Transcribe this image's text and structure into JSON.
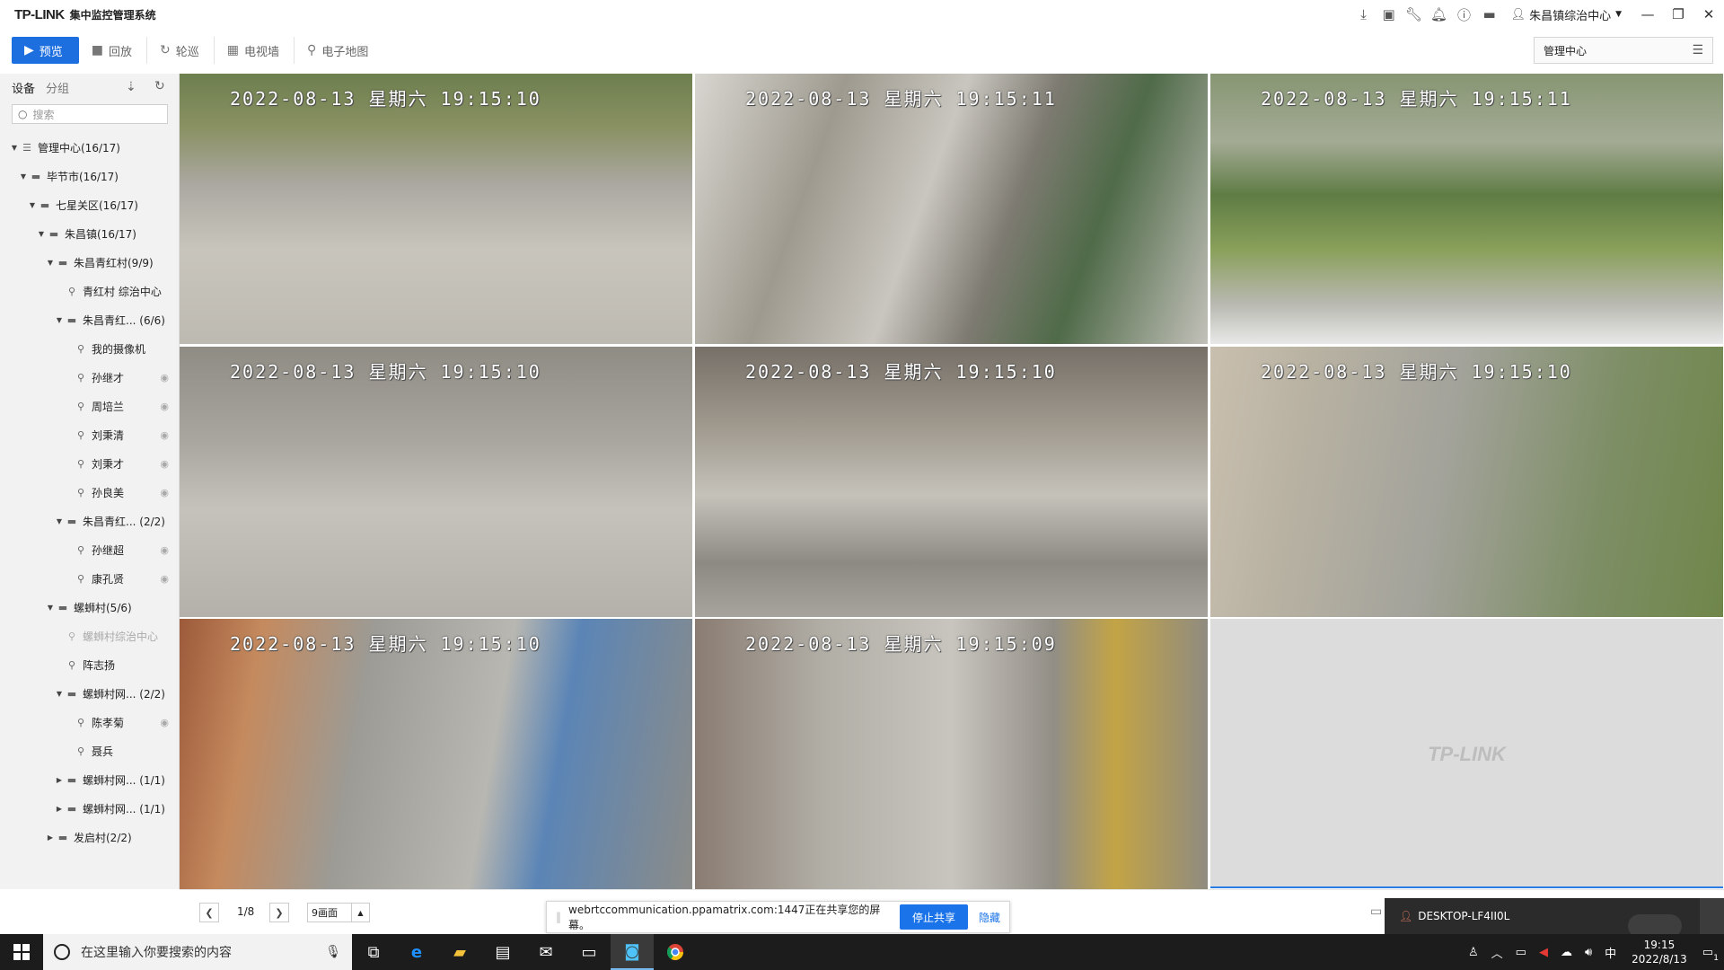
{
  "app": {
    "logo": "TP-LINK",
    "name": "集中监控管理系统",
    "user": "朱昌镇综治中心"
  },
  "toolbar": {
    "tabs": [
      {
        "label": "预览"
      },
      {
        "label": "回放"
      },
      {
        "label": "轮巡"
      },
      {
        "label": "电视墙"
      },
      {
        "label": "电子地图"
      }
    ],
    "center_select": "管理中心"
  },
  "sidebar": {
    "tab_device": "设备",
    "tab_group": "分组",
    "search_placeholder": "搜索",
    "tree": [
      {
        "label": "管理中心(16/17)",
        "level": 0,
        "type": "root",
        "expanded": true
      },
      {
        "label": "毕节市(16/17)",
        "level": 1,
        "type": "folder",
        "expanded": true
      },
      {
        "label": "七星关区(16/17)",
        "level": 2,
        "type": "folder",
        "expanded": true
      },
      {
        "label": "朱昌镇(16/17)",
        "level": 3,
        "type": "folder",
        "expanded": true
      },
      {
        "label": "朱昌青红村(9/9)",
        "level": 4,
        "type": "folder",
        "expanded": true
      },
      {
        "label": "青红村 综治中心",
        "level": 5,
        "type": "camera"
      },
      {
        "label": "朱昌青红...  (6/6)",
        "level": 5,
        "type": "folder",
        "expanded": true
      },
      {
        "label": "我的摄像机",
        "level": 6,
        "type": "camera"
      },
      {
        "label": "孙继才",
        "level": 6,
        "type": "camera",
        "eye": true
      },
      {
        "label": "周培兰",
        "level": 6,
        "type": "camera",
        "eye": true
      },
      {
        "label": "刘秉清",
        "level": 6,
        "type": "camera",
        "eye": true
      },
      {
        "label": "刘秉才",
        "level": 6,
        "type": "camera",
        "eye": true
      },
      {
        "label": "孙良美",
        "level": 6,
        "type": "camera",
        "eye": true
      },
      {
        "label": "朱昌青红...  (2/2)",
        "level": 5,
        "type": "folder",
        "expanded": true
      },
      {
        "label": "孙继超",
        "level": 6,
        "type": "camera",
        "eye": true
      },
      {
        "label": "康孔贤",
        "level": 6,
        "type": "camera",
        "eye": true
      },
      {
        "label": "螺蛳村(5/6)",
        "level": 4,
        "type": "folder",
        "expanded": true
      },
      {
        "label": "螺蛳村综治中心",
        "level": 5,
        "type": "camera",
        "dim": true
      },
      {
        "label": "阵志扬",
        "level": 5,
        "type": "camera"
      },
      {
        "label": "螺蛳村网...  (2/2)",
        "level": 5,
        "type": "folder",
        "expanded": true
      },
      {
        "label": "陈孝菊",
        "level": 6,
        "type": "camera",
        "eye": true
      },
      {
        "label": "聂兵",
        "level": 6,
        "type": "camera"
      },
      {
        "label": "螺蛳村网...  (1/1)",
        "level": 5,
        "type": "folder",
        "expanded": false
      },
      {
        "label": "螺蛳村网...  (1/1)",
        "level": 5,
        "type": "folder",
        "expanded": false
      },
      {
        "label": "发启村(2/2)",
        "level": 4,
        "type": "folder",
        "expanded": false
      }
    ]
  },
  "grid": {
    "cells": [
      {
        "timestamp": "2022-08-13  星期六  19:15:10",
        "scene": "scene-a"
      },
      {
        "timestamp": "2022-08-13  星期六  19:15:11",
        "scene": "scene-b"
      },
      {
        "timestamp": "2022-08-13  星期六  19:15:11",
        "scene": "scene-c"
      },
      {
        "timestamp": "2022-08-13  星期六  19:15:10",
        "scene": "scene-d"
      },
      {
        "timestamp": "2022-08-13  星期六  19:15:10",
        "scene": "scene-e"
      },
      {
        "timestamp": "2022-08-13  星期六  19:15:10",
        "scene": "scene-f"
      },
      {
        "timestamp": "2022-08-13  星期六  19:15:10",
        "scene": "scene-g"
      },
      {
        "timestamp": "2022-08-13  星期六  19:15:09",
        "scene": "scene-h"
      }
    ],
    "empty_watermark": "TP-LINK"
  },
  "pager": {
    "page": "1/8",
    "layout": "9画面"
  },
  "share": {
    "text": "webrtccommunication.ppamatrix.com:1447正在共享您的屏幕。",
    "stop": "停止共享",
    "hide": "隐藏"
  },
  "remote": {
    "host": "DESKTOP-LF4II0L"
  },
  "taskbar": {
    "search_placeholder": "在这里输入你要搜索的内容",
    "ime": "中",
    "time": "19:15",
    "date": "2022/8/13",
    "notif_count": "1"
  }
}
